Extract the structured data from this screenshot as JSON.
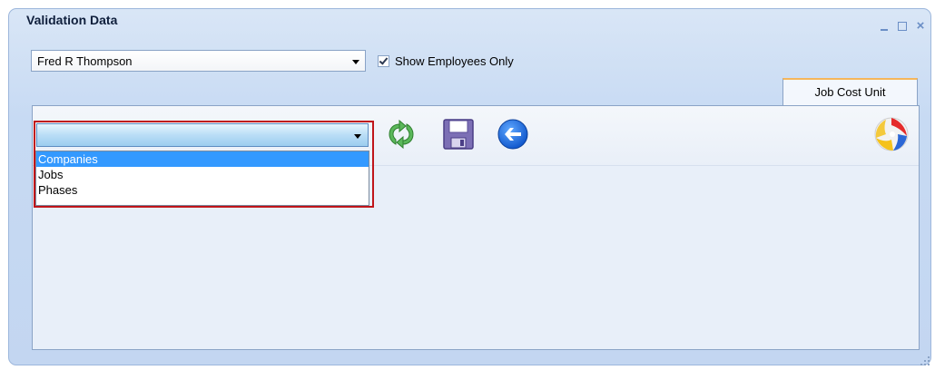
{
  "window": {
    "title": "Validation Data",
    "controls": [
      "minimize-icon",
      "maximize-icon",
      "close-icon"
    ]
  },
  "employee_select": {
    "value": "Fred R Thompson"
  },
  "show_employees_only": {
    "label": "Show Employees Only",
    "checked": true
  },
  "tabs": [
    {
      "label": "Job Cost Unit",
      "active": true
    }
  ],
  "toolbar": {
    "validation_type_select": {
      "value": "",
      "open": true,
      "options": [
        "Companies",
        "Jobs",
        "Phases"
      ],
      "highlighted": "Companies"
    },
    "icons": [
      "refresh-icon",
      "save-icon",
      "back-arrow-icon",
      "beach-ball-icon"
    ]
  },
  "colors": {
    "highlight_frame": "#c0151a",
    "selected_option": "#3399ff",
    "window_bg": "#c7daf3"
  }
}
